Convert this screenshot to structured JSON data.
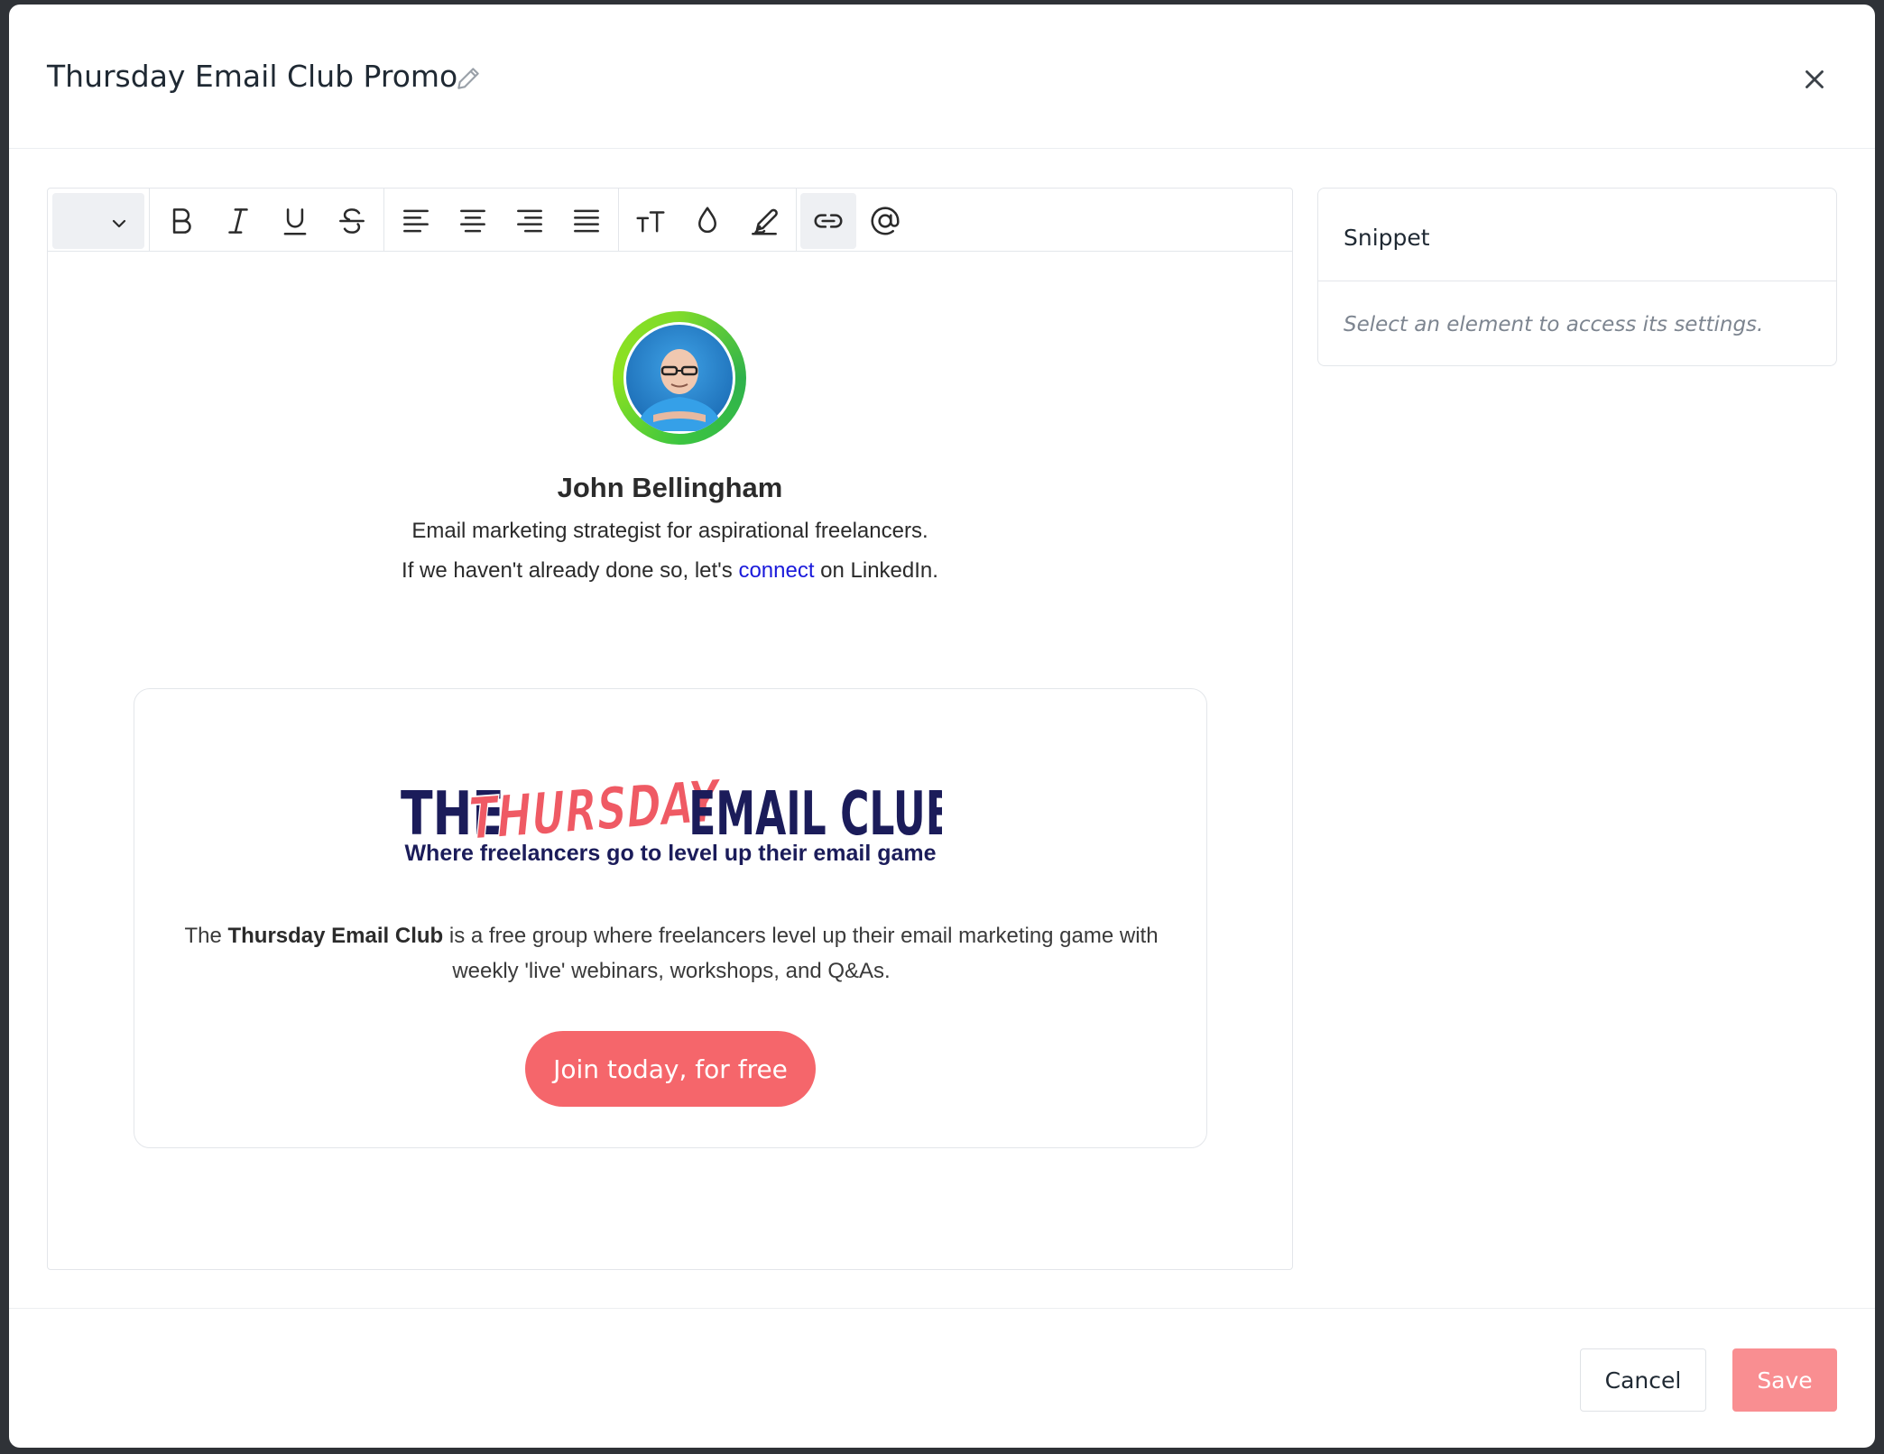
{
  "modal": {
    "title": "Thursday Email Club Promo"
  },
  "toolbar": {
    "icons": [
      "chevron-down-icon",
      "bold-icon",
      "italic-icon",
      "underline-icon",
      "strikethrough-icon",
      "align-left-icon",
      "align-center-icon",
      "align-right-icon",
      "align-justify-icon",
      "font-size-icon",
      "text-color-icon",
      "highlight-icon",
      "link-icon",
      "mention-icon"
    ],
    "active": "link-icon"
  },
  "profile": {
    "name": "John Bellingham",
    "tagline": "Email marketing strategist for aspirational freelancers.",
    "linkedin_prefix": "If we haven't already done so, let's ",
    "linkedin_link": "connect",
    "linkedin_suffix": " on LinkedIn."
  },
  "promo": {
    "logo_text_the": "THE",
    "logo_text_thursday": "THURSDAY",
    "logo_text_club": "EMAIL CLUB",
    "tagline": "Where freelancers go to level up their email game",
    "desc_prefix": "The ",
    "desc_bold": "Thursday Email Club",
    "desc_suffix": " is a free group where freelancers level up their email marketing game with weekly 'live' webinars, workshops, and Q&As.",
    "button_label": "Join today, for free",
    "button_color": "#f5666b"
  },
  "side_panel": {
    "title": "Snippet",
    "hint": "Select an element to access its settings."
  },
  "footer": {
    "cancel_label": "Cancel",
    "save_label": "Save"
  }
}
